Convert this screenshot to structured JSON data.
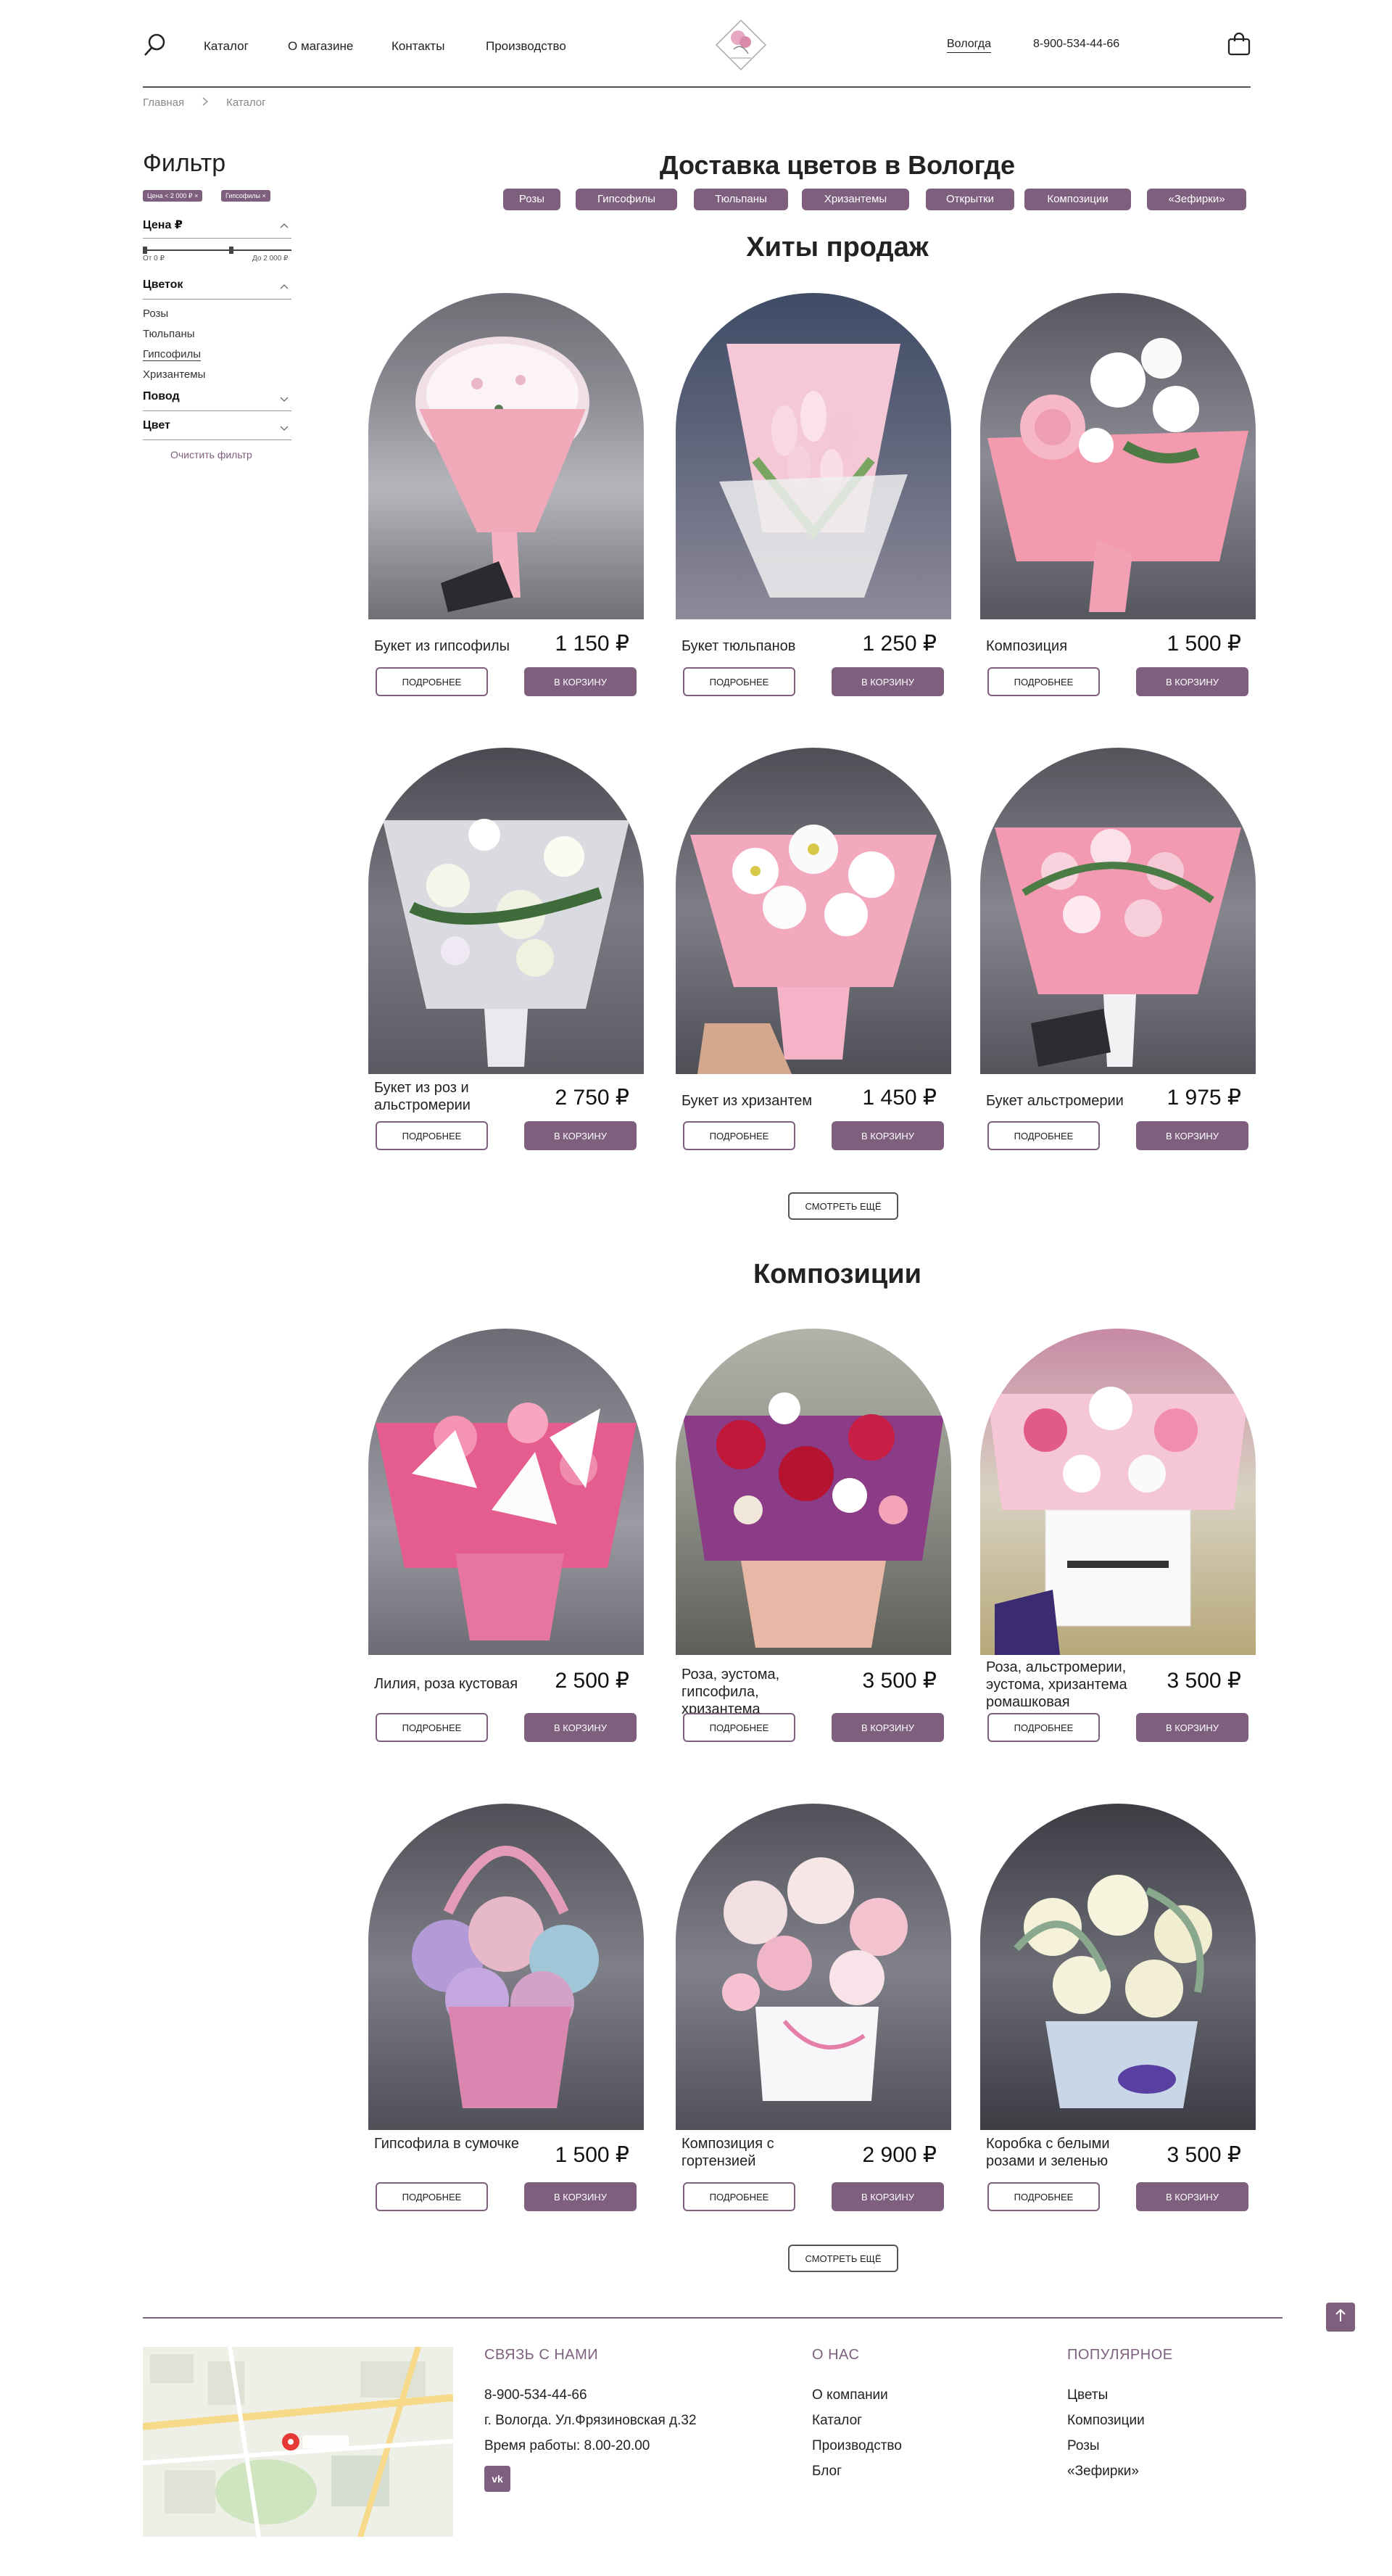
{
  "header": {
    "nav": [
      "Каталог",
      "О магазине",
      "Контакты",
      "Производство"
    ],
    "city": "Вологда",
    "phone": "8-900-534-44-66"
  },
  "breadcrumbs": [
    "Главная",
    "Каталог"
  ],
  "filter": {
    "title": "Фильтр",
    "chips": [
      "Цена < 2 000 ₽ ×",
      "Гипсофилы ×"
    ],
    "price_label": "Цена ₽",
    "price_from": "От 0 ₽",
    "price_to": "До 2 000 ₽",
    "flower_label": "Цветок",
    "flowers": [
      "Розы",
      "Тюльпаны",
      "Гипсофилы",
      "Хризантемы"
    ],
    "occasion_label": "Повод",
    "color_label": "Цвет",
    "clear": "Очистить фильтр"
  },
  "main": {
    "title": "Доставка цветов в Вологде",
    "categories": [
      "Розы",
      "Гипсофилы",
      "Тюльпаны",
      "Хризантемы",
      "Открытки",
      "Композиции",
      "«Зефирки»"
    ],
    "hits_title": "Хиты продаж",
    "compositions_title": "Композиции",
    "more_label": "ПОДРОБНЕЕ",
    "cart_label": "В КОРЗИНУ",
    "see_more": "СМОТРЕТЬ ЕЩЁ"
  },
  "hits": [
    {
      "name": "Букет из гипсофилы",
      "price": "1 150 ₽"
    },
    {
      "name": "Букет тюльпанов",
      "price": "1 250 ₽"
    },
    {
      "name": "Композиция",
      "price": "1 500 ₽"
    },
    {
      "name": "Букет из роз и альстромерии",
      "price": "2 750 ₽"
    },
    {
      "name": "Букет из хризантем",
      "price": "1 450 ₽"
    },
    {
      "name": "Букет альстромерии",
      "price": "1 975 ₽"
    }
  ],
  "compositions": [
    {
      "name": "Лилия, роза кустовая",
      "price": "2 500 ₽"
    },
    {
      "name": "Роза, эустома, гипсофила, хризантема",
      "price": "3 500 ₽"
    },
    {
      "name": "Роза, альстромерии, эустома, хризантема ромашковая",
      "price": "3 500 ₽"
    },
    {
      "name": "Гипсофила в сумочке",
      "price": "1 500 ₽"
    },
    {
      "name": "Композиция с гортензией",
      "price": "2 900 ₽"
    },
    {
      "name": "Коробка с белыми розами и зеленью",
      "price": "3 500 ₽"
    }
  ],
  "footer": {
    "contact_title": "СВЯЗЬ С НАМИ",
    "phone": "8-900-534-44-66",
    "address": "г. Вологда. Ул.Фрязиновская д.32",
    "hours": "Время работы: 8.00-20.00",
    "vk": "vk",
    "about_title": "О НАС",
    "about_links": [
      "О компании",
      "Каталог",
      "Производство",
      "Блог"
    ],
    "popular_title": "ПОПУЛЯРНОЕ",
    "popular_links": [
      "Цветы",
      "Композиции",
      "Розы",
      "«Зефирки»"
    ]
  },
  "colors": {
    "accent": "#7e5f7e",
    "text": "#222222"
  },
  "icons": [
    "search-icon",
    "logo-icon",
    "cart-icon",
    "chevron-right-icon",
    "chevron-up-icon",
    "chevron-down-icon",
    "arrow-up-icon",
    "vk-icon",
    "map-pin-icon"
  ]
}
